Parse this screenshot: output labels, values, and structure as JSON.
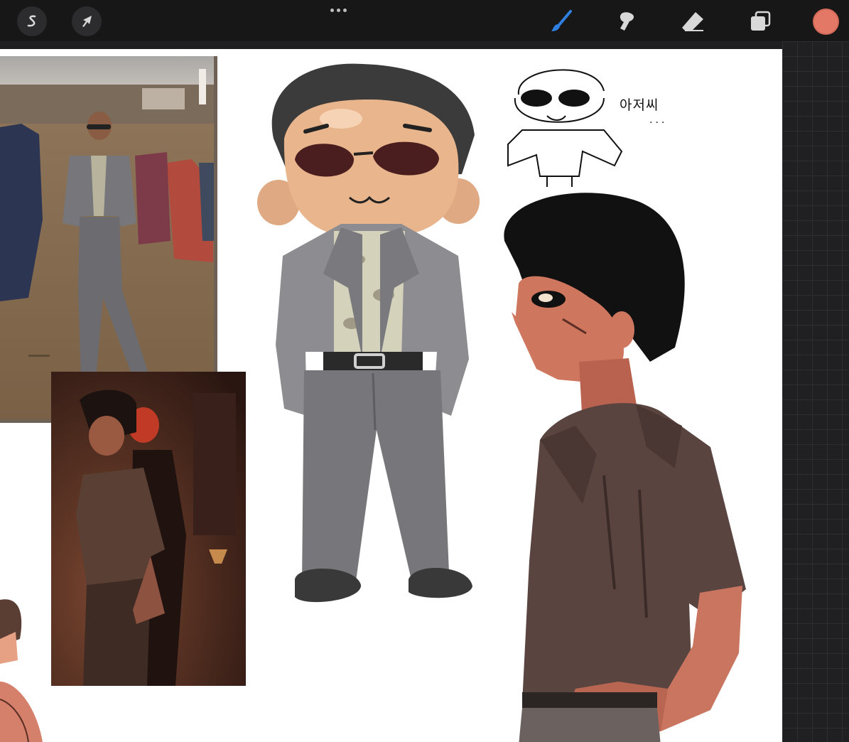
{
  "toolbar": {
    "actions_icon": "wrench-s-icon",
    "selection_icon": "arrow-cursor-icon",
    "more_icon": "ellipsis-icon",
    "brush_icon": "brush-icon",
    "smudge_icon": "smudge-icon",
    "eraser_icon": "eraser-icon",
    "layers_icon": "layers-icon",
    "color": "#e27865",
    "active_tool_color": "#2f7fe0"
  },
  "canvas": {
    "note_korean": "아저씨",
    "note_dots": "..."
  }
}
